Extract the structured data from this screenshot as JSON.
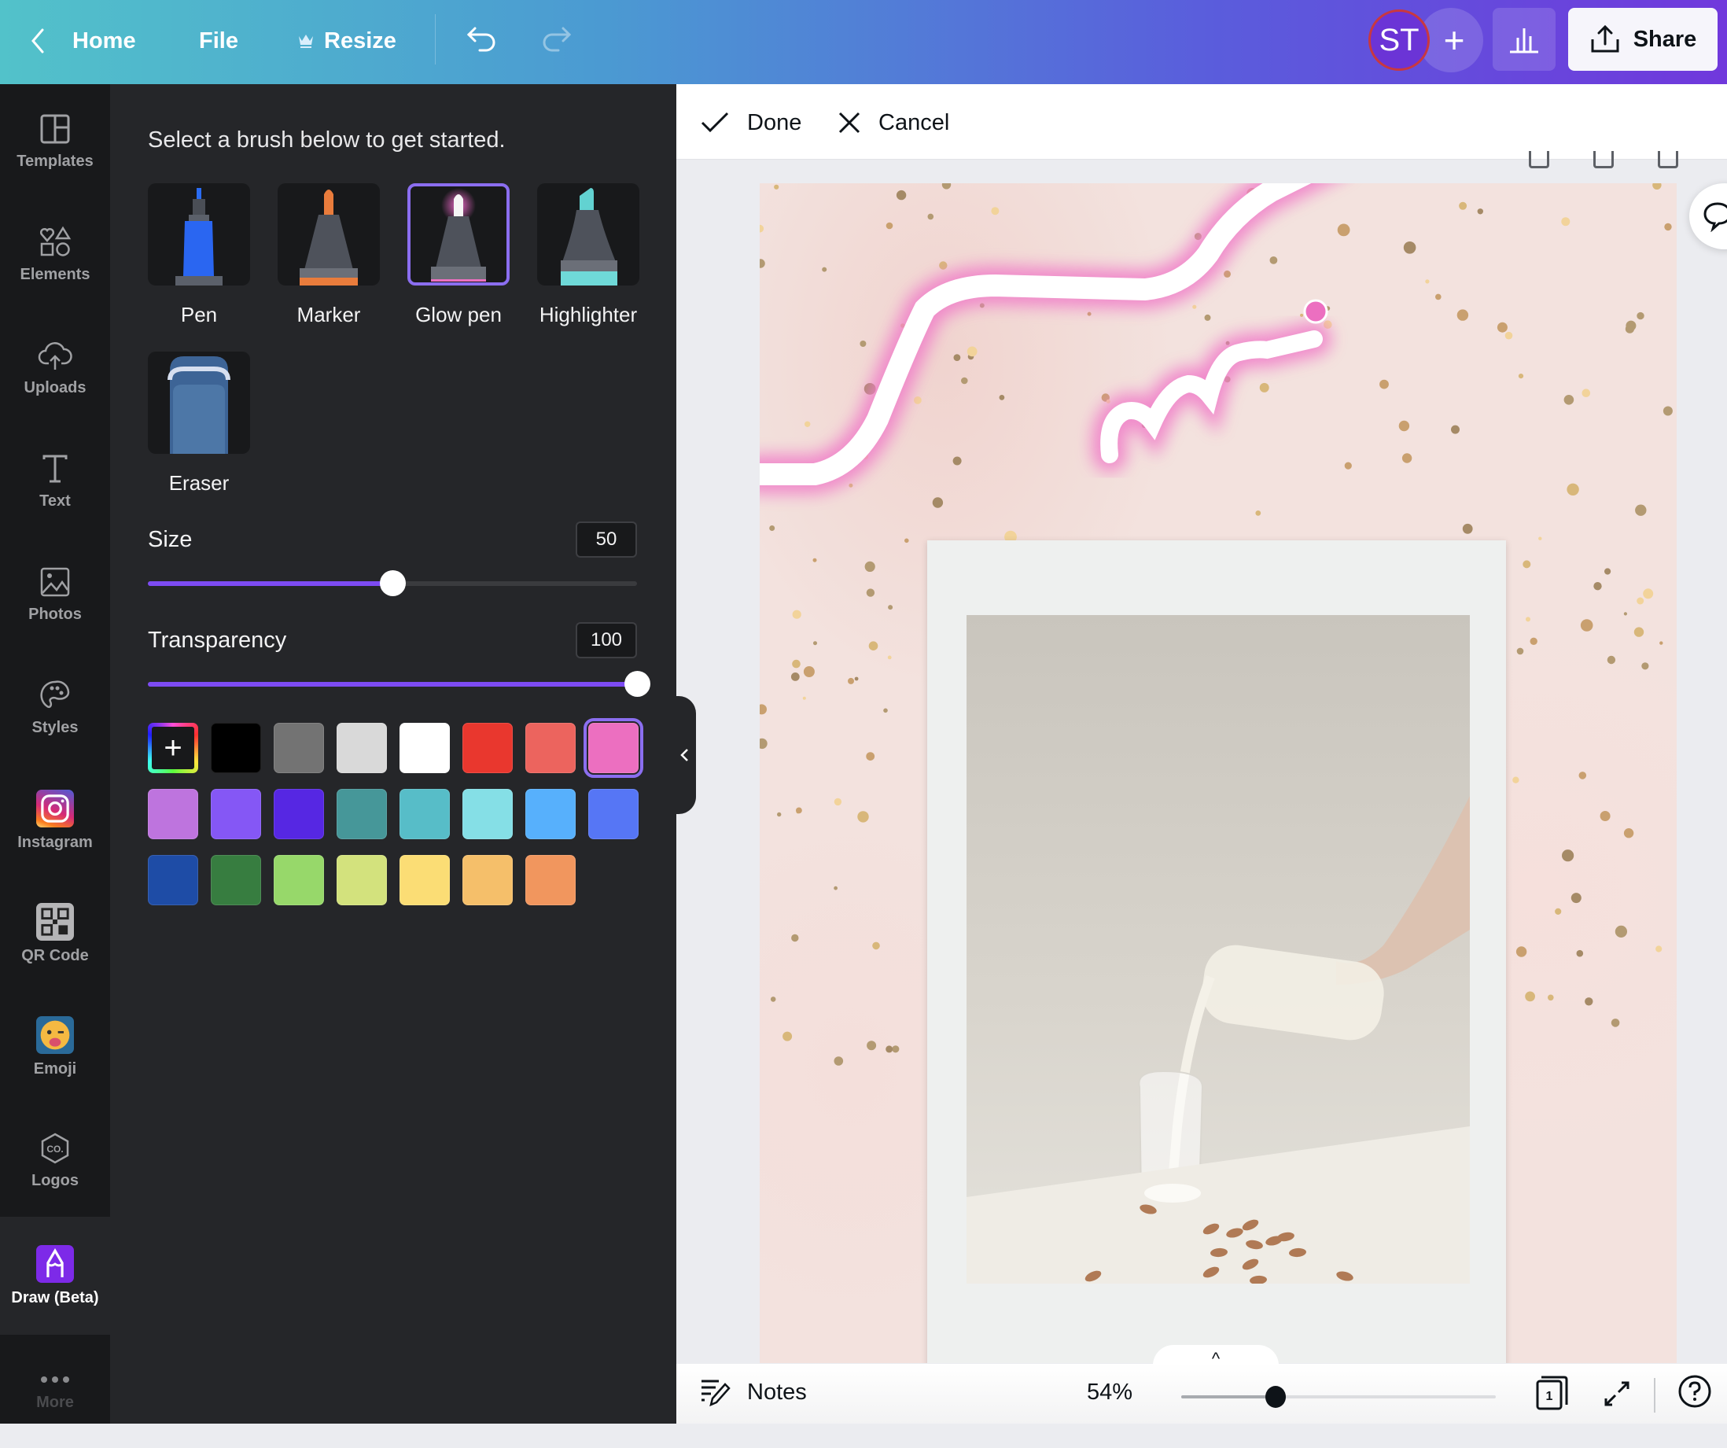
{
  "topbar": {
    "home_label": "Home",
    "file_label": "File",
    "resize_label": "Resize",
    "avatar_initials": "ST",
    "add_collaborator_label": "+",
    "share_label": "Share"
  },
  "sidebar": {
    "items": [
      {
        "label": "Templates",
        "icon": "templates-icon"
      },
      {
        "label": "Elements",
        "icon": "elements-icon"
      },
      {
        "label": "Uploads",
        "icon": "upload-cloud-icon"
      },
      {
        "label": "Text",
        "icon": "text-icon"
      },
      {
        "label": "Photos",
        "icon": "photos-icon"
      },
      {
        "label": "Styles",
        "icon": "palette-icon"
      },
      {
        "label": "Instagram",
        "icon": "instagram-icon"
      },
      {
        "label": "QR Code",
        "icon": "qr-code-icon"
      },
      {
        "label": "Emoji",
        "icon": "emoji-icon"
      },
      {
        "label": "Logos",
        "icon": "logos-icon"
      },
      {
        "label": "Draw (Beta)",
        "icon": "draw-icon",
        "active": true
      },
      {
        "label": "More",
        "icon": "more-dots-icon"
      }
    ]
  },
  "draw_panel": {
    "intro": "Select a brush below to get started.",
    "brushes": [
      {
        "label": "Pen"
      },
      {
        "label": "Marker"
      },
      {
        "label": "Glow pen",
        "selected": true
      },
      {
        "label": "Highlighter"
      },
      {
        "label": "Eraser"
      }
    ],
    "size": {
      "label": "Size",
      "value": "50",
      "fraction": 0.5
    },
    "transparency": {
      "label": "Transparency",
      "value": "100",
      "fraction": 1.0
    },
    "colors": {
      "add_label": "+",
      "selected": "#ec6fc0",
      "swatches": [
        "#000000",
        "#737373",
        "#d9d9d9",
        "#ffffff",
        "#e9372e",
        "#ec645e",
        "#ec6fc0",
        "#be74de",
        "#8557f5",
        "#5627e3",
        "#469799",
        "#57bdc8",
        "#85dfe6",
        "#57b0fc",
        "#5676f5",
        "#1e4ca6",
        "#377d40",
        "#97d86a",
        "#d3e27d",
        "#fbdd75",
        "#f5bf6a",
        "#f1965e"
      ]
    }
  },
  "editbar": {
    "done_label": "Done",
    "cancel_label": "Cancel"
  },
  "bottombar": {
    "notes_label": "Notes",
    "zoom_value": "54%",
    "zoom_fraction": 0.3,
    "page_number": "1",
    "pages_toggle": "^"
  }
}
